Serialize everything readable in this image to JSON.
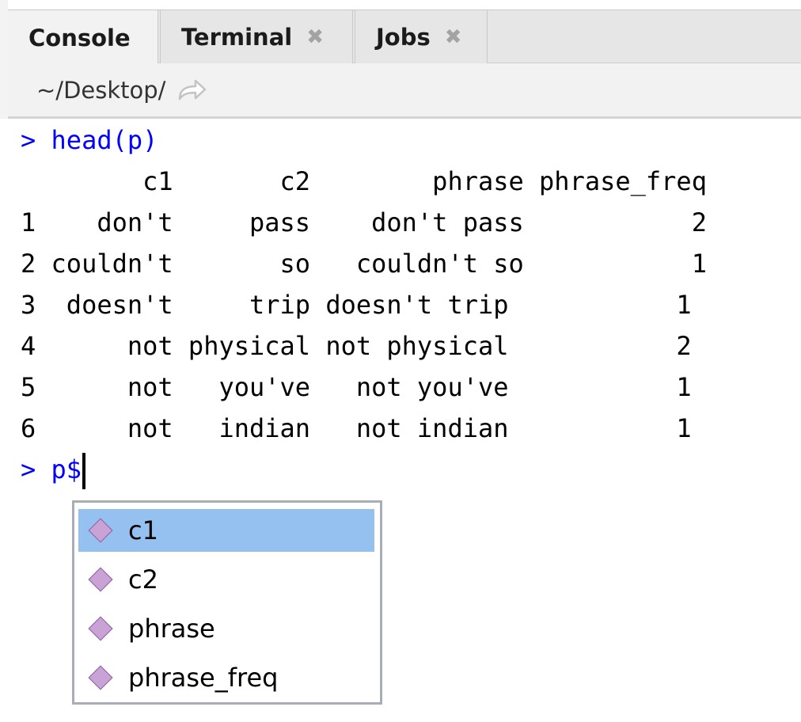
{
  "tabs": [
    {
      "label": "Console",
      "closable": false,
      "active": true
    },
    {
      "label": "Terminal",
      "closable": true,
      "close_glyph": "✖",
      "active": false
    },
    {
      "label": "Jobs",
      "closable": true,
      "close_glyph": "✖",
      "active": false
    }
  ],
  "path": {
    "text": "~/Desktop/",
    "go_icon": "arrow-redirect-icon"
  },
  "console": {
    "lines": [
      {
        "prompt": "> ",
        "input": "head(p)"
      },
      {
        "text": "        c1       c2        phrase phrase_freq"
      },
      {
        "text": "1    don't     pass    don't pass           2"
      },
      {
        "text": "2 couldn't       so   couldn't so           1"
      },
      {
        "text": "3  doesn't     trip doesn't trip           1"
      },
      {
        "text": "4      not physical not physical           2"
      },
      {
        "text": "5      not   you've   not you've           1"
      },
      {
        "text": "6      not   indian   not indian           1"
      },
      {
        "prompt": "> ",
        "input": "p$"
      }
    ]
  },
  "autocomplete": {
    "items": [
      {
        "label": "c1",
        "selected": true
      },
      {
        "label": "c2",
        "selected": false
      },
      {
        "label": "phrase",
        "selected": false
      },
      {
        "label": "phrase_freq",
        "selected": false
      }
    ],
    "item_icon": "diamond-variable-icon"
  },
  "colors": {
    "prompt": "#0000ff",
    "selection": "#94c1f0",
    "tab_bar": "#e6e6e6",
    "diamond": "#caa3d6"
  }
}
